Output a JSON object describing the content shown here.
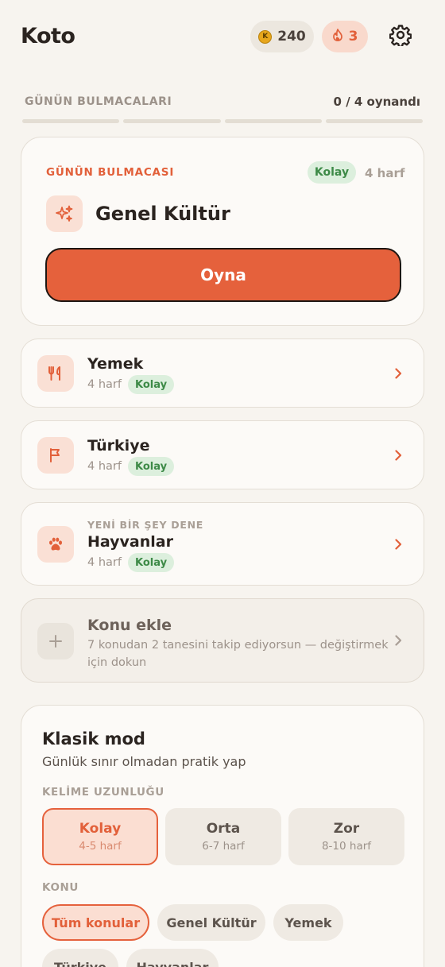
{
  "header": {
    "logo": "Koto",
    "coins": "240",
    "coin_symbol": "K",
    "streak": "3"
  },
  "progress": {
    "label": "GÜNÜN BULMACALARI",
    "count": "0 / 4 oynandı",
    "played": 0,
    "total": 4
  },
  "daily": {
    "kicker": "GÜNÜN BULMACASI",
    "difficulty": "Kolay",
    "letters": "4 harf",
    "title": "Genel Kültür",
    "icon": "sparkles-icon",
    "play_label": "Oyna"
  },
  "topics": [
    {
      "name": "Yemek",
      "letters": "4 harf",
      "difficulty": "Kolay",
      "icon": "utensils-icon"
    },
    {
      "name": "Türkiye",
      "letters": "4 harf",
      "difficulty": "Kolay",
      "icon": "flag-icon"
    },
    {
      "kicker": "YENİ BİR ŞEY DENE",
      "name": "Hayvanlar",
      "letters": "4 harf",
      "difficulty": "Kolay",
      "icon": "paw-icon"
    }
  ],
  "add_topic": {
    "title": "Konu ekle",
    "description": "7 konudan 2 tanesini takip ediyorsun — değiştirmek için dokun",
    "icon": "plus-icon"
  },
  "classic": {
    "title": "Klasik mod",
    "subtitle": "Günlük sınır olmadan pratik yap",
    "length_label": "KELİME UZUNLUĞU",
    "levels": [
      {
        "name": "Kolay",
        "range": "4-5 harf",
        "selected": true
      },
      {
        "name": "Orta",
        "range": "6-7 harf",
        "selected": false
      },
      {
        "name": "Zor",
        "range": "8-10 harf",
        "selected": false
      }
    ],
    "topic_label": "KONU",
    "chips": [
      "Tüm konular",
      "Genel Kültür",
      "Yemek",
      "Türkiye",
      "Hayvanlar"
    ],
    "selected_chip": "Tüm konular"
  },
  "colors": {
    "accent": "#e5613c",
    "background": "#f7f4ef",
    "easy_badge_bg": "#dcefdd",
    "easy_badge_text": "#3d8a47"
  }
}
